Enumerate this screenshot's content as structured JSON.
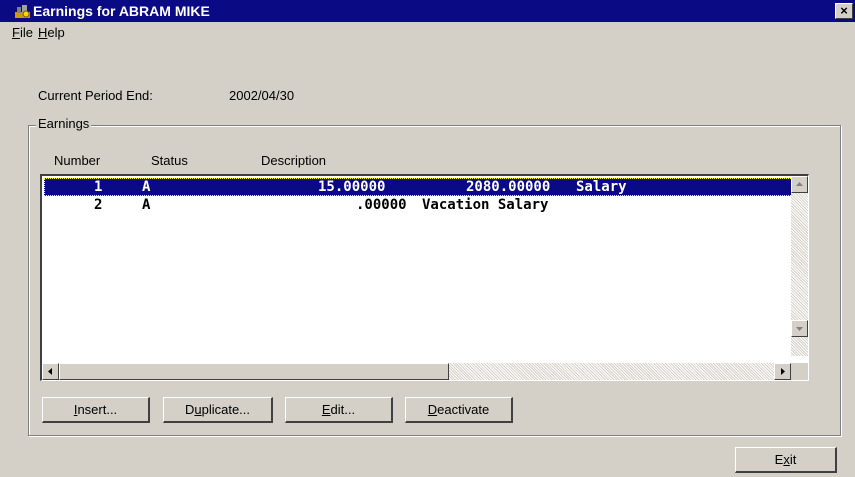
{
  "window": {
    "title": "Earnings for ABRAM MIKE",
    "close_label": "×"
  },
  "menu": {
    "file_first": "F",
    "file_rest": "ile",
    "help_first": "H",
    "help_rest": "elp"
  },
  "period": {
    "label": "Current Period End:",
    "value": "2002/04/30"
  },
  "earnings": {
    "group_label": "Earnings",
    "columns": [
      "Number",
      "Status",
      "Description"
    ],
    "rows": [
      {
        "number": "1",
        "status": "A",
        "amount": "15.00000",
        "hours": "2080.00000",
        "description": "Salary",
        "selected": true
      },
      {
        "number": "2",
        "status": "A",
        "amount": "",
        "hours": ".00000",
        "description": "Vacation Salary",
        "selected": false
      }
    ]
  },
  "buttons": {
    "insert": {
      "u": "I",
      "rest": "nsert..."
    },
    "duplicate": {
      "pre": "D",
      "u": "u",
      "rest": "plicate..."
    },
    "edit": {
      "u": "E",
      "rest": "dit..."
    },
    "deactivate": {
      "u": "D",
      "rest": "eactivate"
    },
    "exit": {
      "pre": "E",
      "u": "x",
      "rest": "it"
    }
  },
  "icons": {
    "app": "app-icon",
    "close": "close-icon",
    "scroll_up": "arrow-up-icon",
    "scroll_down": "arrow-down-icon",
    "scroll_left": "arrow-left-icon",
    "scroll_right": "arrow-right-icon"
  },
  "colors": {
    "titlebar": "#0a0a84",
    "face": "#d4d0c8",
    "selection": "#0a0a84"
  }
}
